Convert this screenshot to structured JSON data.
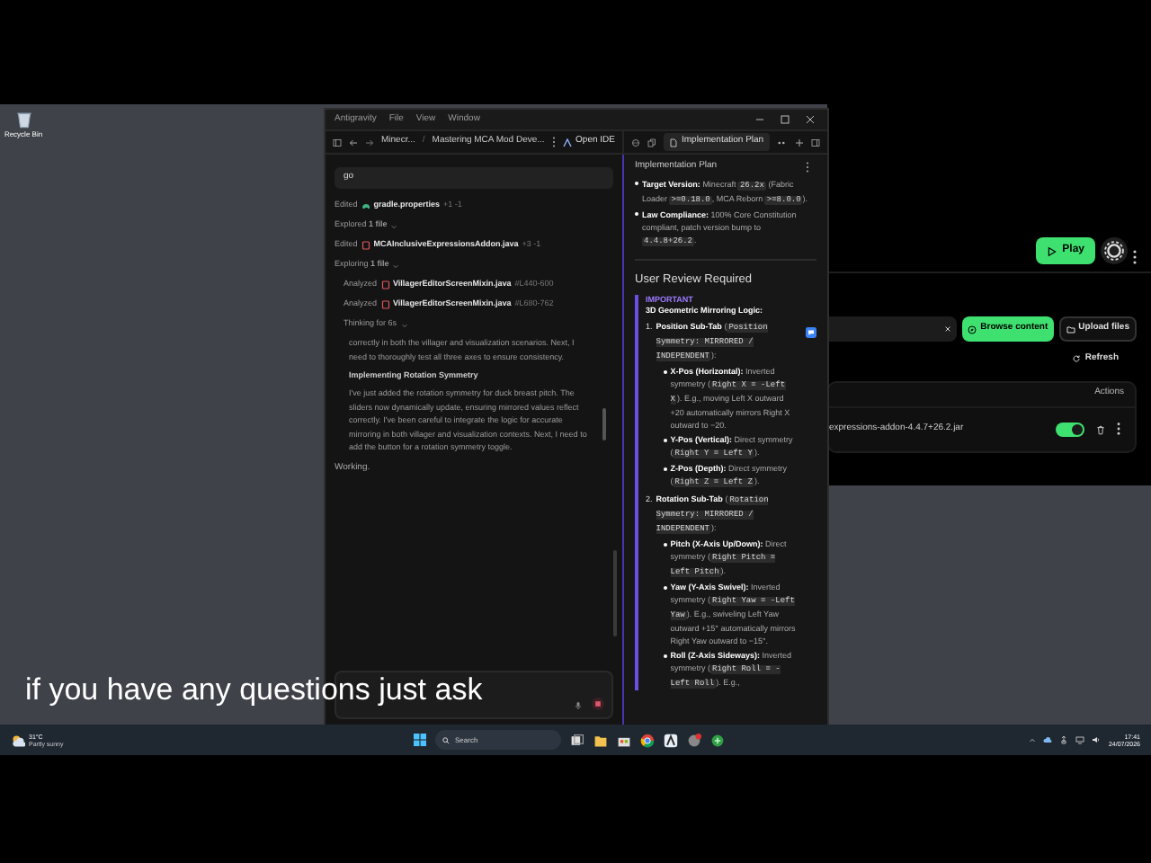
{
  "desktop_icons": [
    {
      "label": "Recycle Bin"
    }
  ],
  "launcher": {
    "play": "Play",
    "browse": "Browse content",
    "upload": "Upload files",
    "refresh": "Refresh",
    "column": "Actions",
    "rows": [
      {
        "file": "expressions-addon-4.4.7+26.2.jar",
        "enabled": true
      }
    ]
  },
  "window": {
    "menu": [
      "Antigravity",
      "File",
      "View",
      "Window"
    ],
    "breadcrumbs": [
      "Minecr...",
      "Mastering MCA Mod Deve..."
    ],
    "breadcrumb_separator": "/",
    "open_ide": "Open IDE",
    "tab": "Implementation Plan"
  },
  "chat": {
    "input": "go",
    "steps": [
      {
        "kind": "gradle_file",
        "verb": "Edited",
        "file": "gradle.properties",
        "detail": "+1 -1",
        "nested": false
      },
      {
        "kind": "summary",
        "text": "Explored **1 file**",
        "nested": false
      },
      {
        "kind": "java_file",
        "verb": "Edited",
        "file": "MCAInclusiveExpressionsAddon.java",
        "detail": "+3 -1",
        "nested": false
      },
      {
        "kind": "summary",
        "text": "Exploring **1 file**",
        "nested": false
      },
      {
        "kind": "java_file",
        "verb": "Analyzed",
        "file": "VillagerEditorScreenMixin.java",
        "detail": "#L440-600",
        "nested": true
      },
      {
        "kind": "java_file",
        "verb": "Analyzed",
        "file": "VillagerEditorScreenMixin.java",
        "detail": "#L680-762",
        "nested": true
      },
      {
        "kind": "summary",
        "text": "Thinking for 6s",
        "nested": true
      }
    ],
    "thoughts": [
      {
        "kind": "paragraph",
        "text": "correctly in both the villager and visualization scenarios. Next, I need to thoroughly test all three axes to ensure consistency."
      },
      {
        "kind": "heading",
        "text": "Implementing Rotation Symmetry"
      },
      {
        "kind": "paragraph",
        "text": "I've just added the rotation symmetry for duck breast pitch. The sliders now dynamically update, ensuring mirrored values reflect correctly. I've been careful to integrate the logic for accurate mirroring in both villager and visualization contexts. Next, I need to add the button for a rotation symmetry toggle."
      }
    ],
    "status": "Working."
  },
  "plan": {
    "title": "Implementation Plan",
    "bullets": [
      [
        {
          "kind": "bold",
          "text": "Target Version:"
        },
        {
          "kind": "text",
          "text": " Minecraft "
        },
        {
          "kind": "code",
          "text": "26.2x"
        },
        {
          "kind": "text",
          "text": " (Fabric Loader "
        },
        {
          "kind": "code",
          "text": ">=0.18.0"
        },
        {
          "kind": "text",
          "text": ", MCA Reborn "
        },
        {
          "kind": "code",
          "text": ">=8.0.0"
        },
        {
          "kind": "text",
          "text": ")."
        }
      ],
      [
        {
          "kind": "bold",
          "text": "Law Compliance:"
        },
        {
          "kind": "text",
          "text": " 100% Core Constitution compliant, patch version bump to "
        },
        {
          "kind": "code",
          "text": "4.4.8+26.2"
        },
        {
          "kind": "text",
          "text": "."
        }
      ]
    ],
    "section": "User Review Required",
    "alert": {
      "label": "IMPORTANT",
      "title": "3D Geometric Mirroring Logic:",
      "items": [
        {
          "number": "1.",
          "segments": [
            {
              "kind": "bold",
              "text": "Position Sub-Tab"
            },
            {
              "kind": "text",
              "text": " ("
            },
            {
              "kind": "code",
              "text": "Position Symmetry: MIRRORED / INDEPENDENT"
            },
            {
              "kind": "text",
              "text": "):"
            }
          ],
          "children": [
            [
              {
                "kind": "bold",
                "text": "X-Pos (Horizontal):"
              },
              {
                "kind": "text",
                "text": " Inverted symmetry ("
              },
              {
                "kind": "code",
                "text": "Right X = -Left X"
              },
              {
                "kind": "text",
                "text": "). E.g., moving Left X outward +20 automatically mirrors Right X outward to −20."
              }
            ],
            [
              {
                "kind": "bold",
                "text": "Y-Pos (Vertical):"
              },
              {
                "kind": "text",
                "text": " Direct symmetry ("
              },
              {
                "kind": "code",
                "text": "Right Y = Left Y"
              },
              {
                "kind": "text",
                "text": ")."
              }
            ],
            [
              {
                "kind": "bold",
                "text": "Z-Pos (Depth):"
              },
              {
                "kind": "text",
                "text": " Direct symmetry ("
              },
              {
                "kind": "code",
                "text": "Right Z = Left Z"
              },
              {
                "kind": "text",
                "text": ")."
              }
            ]
          ]
        },
        {
          "number": "2.",
          "segments": [
            {
              "kind": "bold",
              "text": "Rotation Sub-Tab"
            },
            {
              "kind": "text",
              "text": " ("
            },
            {
              "kind": "code",
              "text": "Rotation Symmetry: MIRRORED / INDEPENDENT"
            },
            {
              "kind": "text",
              "text": "):"
            }
          ],
          "children": [
            [
              {
                "kind": "bold",
                "text": "Pitch (X-Axis Up/Down):"
              },
              {
                "kind": "text",
                "text": " Direct symmetry ("
              },
              {
                "kind": "code",
                "text": "Right Pitch = Left Pitch"
              },
              {
                "kind": "text",
                "text": ")."
              }
            ],
            [
              {
                "kind": "bold",
                "text": "Yaw (Y-Axis Swivel):"
              },
              {
                "kind": "text",
                "text": " Inverted symmetry ("
              },
              {
                "kind": "code",
                "text": "Right Yaw = -Left Yaw"
              },
              {
                "kind": "text",
                "text": "). E.g., swiveling Left Yaw outward +15° automatically mirrors Right Yaw outward to −15°."
              }
            ],
            [
              {
                "kind": "bold",
                "text": "Roll (Z-Axis Sideways):"
              },
              {
                "kind": "text",
                "text": " Inverted symmetry ("
              },
              {
                "kind": "code",
                "text": "Right Roll = -Left Roll"
              },
              {
                "kind": "text",
                "text": "). E.g.,"
              }
            ]
          ]
        }
      ]
    }
  },
  "subtitle": "if you have any questions just ask",
  "taskbar": {
    "temperature": "31°C",
    "weather": "Partly sunny",
    "search": "Search",
    "time": "17:41",
    "date": "24/07/2026"
  }
}
